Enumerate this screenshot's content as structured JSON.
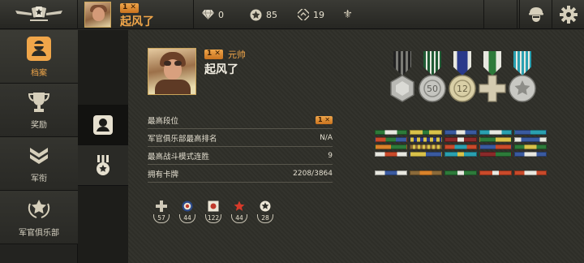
{
  "top": {
    "player_name": "起风了",
    "rank_badge": "1 ✕",
    "currencies": [
      {
        "icon": "diamond-icon",
        "value": "0"
      },
      {
        "icon": "gold-star-coin-icon",
        "value": "85"
      },
      {
        "icon": "rank-chevron-token-icon",
        "value": "19"
      },
      {
        "icon": "fleur-de-lis-icon",
        "value": ""
      }
    ]
  },
  "sidebar": {
    "items": [
      {
        "label": "档案",
        "icon": "profile-card-icon",
        "active": true
      },
      {
        "label": "奖励",
        "icon": "trophy-icon"
      },
      {
        "label": "军衔",
        "icon": "chevron-rank-icon"
      },
      {
        "label": "军官俱乐部",
        "icon": "laurel-star-icon"
      }
    ]
  },
  "profile": {
    "rank_badge": "1 ✕",
    "title": "元帅",
    "name": "起风了",
    "stats": [
      {
        "label": "最高段位",
        "value": "1 ✕",
        "type": "badge"
      },
      {
        "label": "军官俱乐部最高排名",
        "value": "N/A"
      },
      {
        "label": "最高战斗模式连胜",
        "value": "9"
      },
      {
        "label": "拥有卡牌",
        "value": "2208/3864"
      }
    ],
    "tokens": [
      {
        "icon": "iron-cross-icon",
        "value": "57"
      },
      {
        "icon": "roundel-icon",
        "value": "44"
      },
      {
        "icon": "rising-sun-icon",
        "value": "122"
      },
      {
        "icon": "red-star-icon",
        "value": "44"
      },
      {
        "icon": "allied-star-icon",
        "value": "28"
      }
    ],
    "medals": [
      {
        "icon": "hexagon-medal-icon",
        "label": ""
      },
      {
        "icon": "50-medal-icon",
        "label": "50"
      },
      {
        "icon": "12-medal-icon",
        "label": "12"
      },
      {
        "icon": "cross-medal-icon",
        "label": ""
      },
      {
        "icon": "star-medal-icon",
        "label": ""
      }
    ]
  },
  "colors": {
    "accent": "#f0a64a",
    "gold": "#c9a45a",
    "panel": "#2f2f29"
  }
}
